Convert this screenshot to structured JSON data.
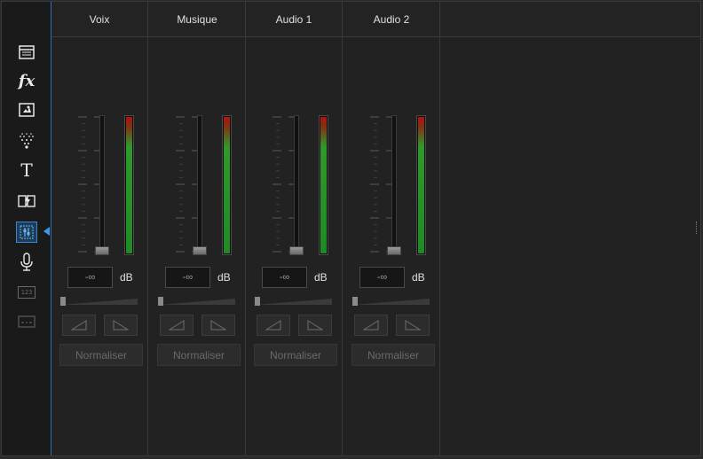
{
  "toolbar": {
    "items": [
      {
        "name": "media-room",
        "icon": "clapperboard-icon"
      },
      {
        "name": "fx-room",
        "icon": "fx-icon",
        "label": "fx"
      },
      {
        "name": "pip-room",
        "icon": "pip-objects-icon"
      },
      {
        "name": "particle-room",
        "icon": "particle-icon"
      },
      {
        "name": "title-room",
        "icon": "title-icon",
        "label": "T"
      },
      {
        "name": "transition-room",
        "icon": "transition-icon"
      },
      {
        "name": "audio-mixing-room",
        "icon": "audio-mixer-icon",
        "active": true
      },
      {
        "name": "voiceover-room",
        "icon": "microphone-icon"
      },
      {
        "name": "chapter-room",
        "icon": "chapter-icon",
        "label": "123",
        "disabled": true
      },
      {
        "name": "subtitle-room",
        "icon": "subtitle-icon",
        "disabled": true
      }
    ]
  },
  "mixer": {
    "channels": [
      {
        "title": "Voix",
        "volume": "-∞",
        "unit": "dB",
        "normalize": "Normaliser"
      },
      {
        "title": "Musique",
        "volume": "-∞",
        "unit": "dB",
        "normalize": "Normaliser"
      },
      {
        "title": "Audio 1",
        "volume": "-∞",
        "unit": "dB",
        "normalize": "Normaliser"
      },
      {
        "title": "Audio 2",
        "volume": "-∞",
        "unit": "dB",
        "normalize": "Normaliser"
      }
    ]
  },
  "colors": {
    "accent": "#3a9ae8",
    "meter_green": "#1e8c23",
    "meter_red": "#b01414",
    "background": "#222222"
  }
}
